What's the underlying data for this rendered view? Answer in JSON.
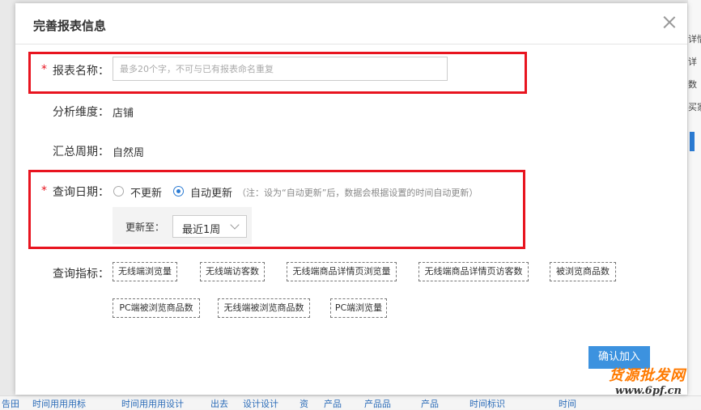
{
  "background": {
    "right_fragments": [
      "详情",
      "详",
      "数",
      "买家"
    ],
    "bottom_links": [
      "告田",
      "时间用用用标",
      "时间用用用设计",
      "出去",
      "设计设计",
      "资",
      "产品",
      "产品品",
      "产品",
      "时间标识",
      "时间"
    ]
  },
  "modal": {
    "title": "完善报表信息",
    "report_name": {
      "required_mark": "*",
      "label": "报表名称：",
      "placeholder": "最多20个字，不可与已有报表命名重复"
    },
    "dimension": {
      "label": "分析维度：",
      "value": "店铺"
    },
    "period": {
      "label": "汇总周期：",
      "value": "自然周"
    },
    "query_date": {
      "required_mark": "*",
      "label": "查询日期：",
      "options": [
        "不更新",
        "自动更新"
      ],
      "selected": "自动更新",
      "note": "（注：设为“自动更新”后，数据会根据设置的时间自动更新）",
      "update_to_label": "更新至：",
      "update_to_value": "最近1周"
    },
    "metrics": {
      "label": "查询指标：",
      "tags": [
        "无线端浏览量",
        "无线端访客数",
        "无线端商品详情页浏览量",
        "无线端商品详情页访客数",
        "被浏览商品数",
        "PC端被浏览商品数",
        "无线端被浏览商品数",
        "PC端浏览量"
      ]
    },
    "confirm_label": "确认加入"
  },
  "watermark": {
    "text": "货源批发网",
    "url": "www.6pf.cn"
  },
  "colors": {
    "required": "#e8141f",
    "highlight_box": "#e8141f",
    "primary": "#3c92df",
    "watermark": "#ff7a00"
  }
}
